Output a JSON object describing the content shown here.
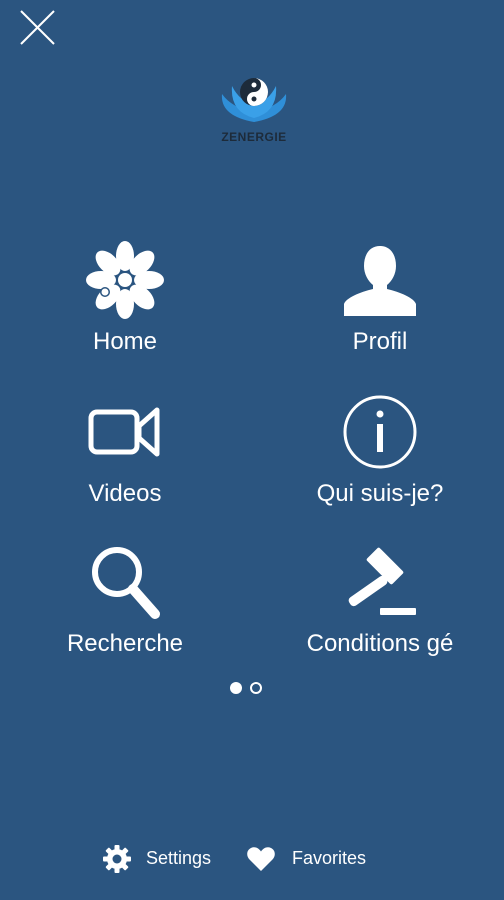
{
  "header": {
    "close_icon": "close-icon",
    "logo_text": "ZENERGIE"
  },
  "menu": {
    "items": [
      {
        "label": "Home",
        "icon": "flower-icon"
      },
      {
        "label": "Profil",
        "icon": "user-silhouette-icon"
      },
      {
        "label": "Videos",
        "icon": "video-camera-icon"
      },
      {
        "label": "Qui suis-je?",
        "icon": "info-icon"
      },
      {
        "label": "Recherche",
        "icon": "magnifier-icon"
      },
      {
        "label": "Conditions gé",
        "icon": "gavel-icon"
      }
    ]
  },
  "pager": {
    "pages": 2,
    "current": 1
  },
  "footer": {
    "settings_label": "Settings",
    "favorites_label": "Favorites"
  },
  "colors": {
    "background": "#2b5580",
    "foreground": "#ffffff",
    "logo_blue": "#2f8fd8",
    "logo_text": "#1d2b3a"
  }
}
